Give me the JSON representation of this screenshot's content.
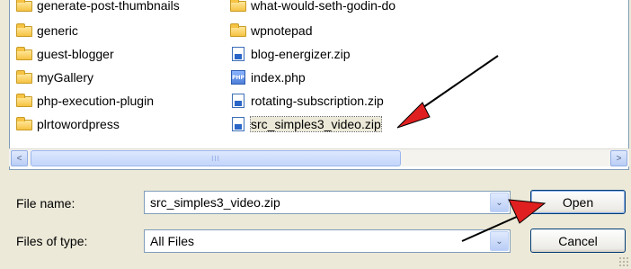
{
  "files": {
    "left_column": [
      {
        "name": "generate-post-thumbnails",
        "type": "folder"
      },
      {
        "name": "generic",
        "type": "folder"
      },
      {
        "name": "guest-blogger",
        "type": "folder"
      },
      {
        "name": "myGallery",
        "type": "folder"
      },
      {
        "name": "php-execution-plugin",
        "type": "folder"
      },
      {
        "name": "plrtowordpress",
        "type": "folder"
      }
    ],
    "right_column": [
      {
        "name": "what-would-seth-godin-do",
        "type": "folder"
      },
      {
        "name": "wpnotepad",
        "type": "folder"
      },
      {
        "name": "blog-energizer.zip",
        "type": "zip"
      },
      {
        "name": "index.php",
        "type": "php"
      },
      {
        "name": "rotating-subscription.zip",
        "type": "zip"
      },
      {
        "name": "src_simples3_video.zip",
        "type": "zip",
        "selected": true
      }
    ]
  },
  "scrollbar": {
    "left_arrow": "<",
    "right_arrow": ">",
    "thumb_grip": "III"
  },
  "form": {
    "file_name_label": "File name:",
    "file_name_value": "src_simples3_video.zip",
    "files_of_type_label": "Files of type:",
    "files_of_type_value": "All Files",
    "dropdown_glyph": "⌄"
  },
  "buttons": {
    "open": "Open",
    "cancel": "Cancel"
  },
  "icons": {
    "php_icon_text": "PHP"
  },
  "annotation": {
    "arrow_color": "#e02020"
  }
}
